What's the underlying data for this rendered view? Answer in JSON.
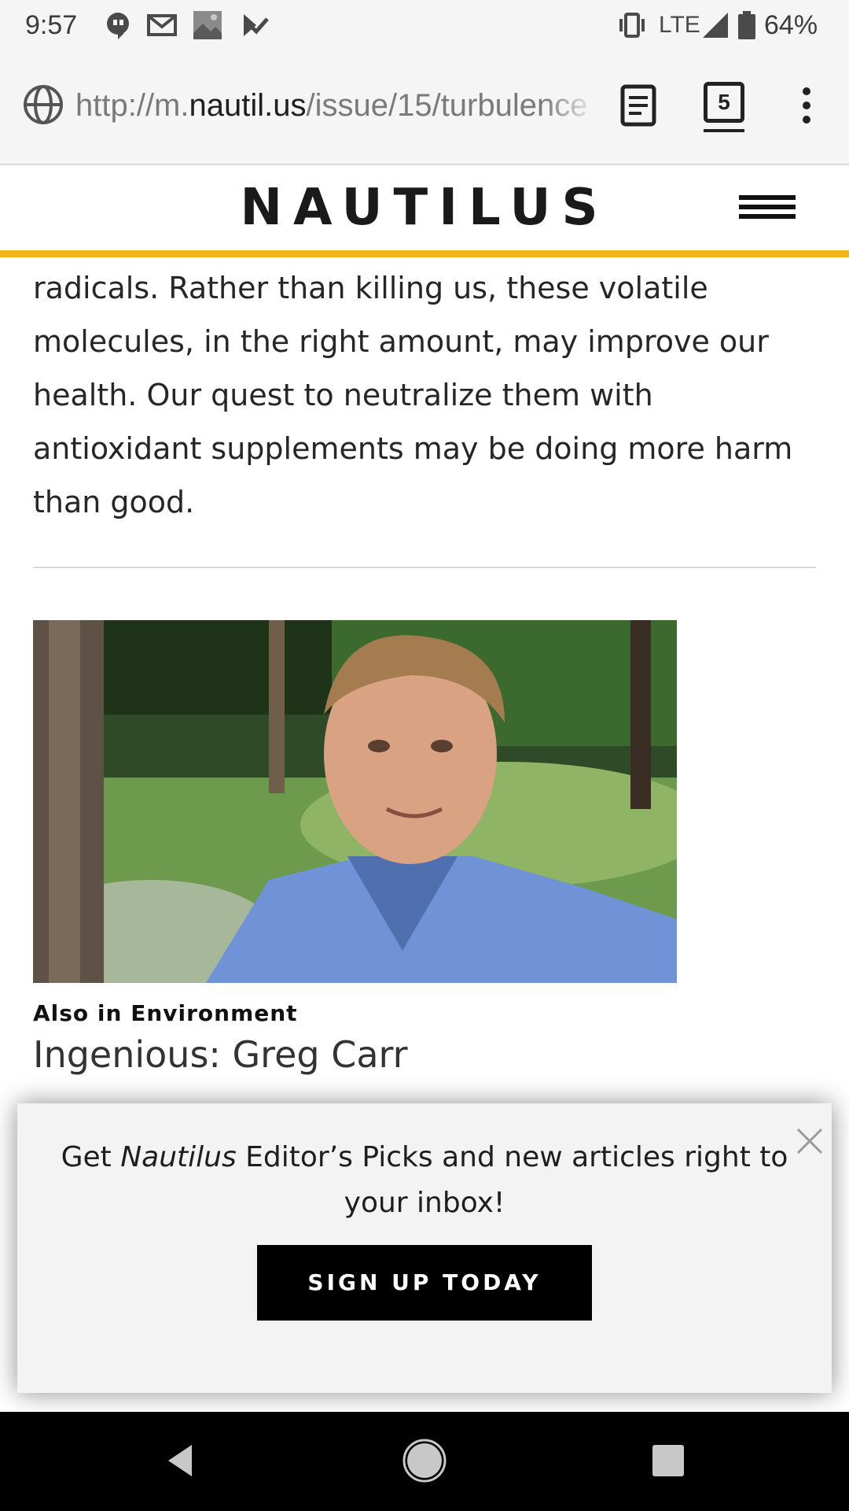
{
  "status_bar": {
    "time": "9:57",
    "network": "LTE",
    "battery": "64%",
    "icons": [
      "hangouts-icon",
      "gmail-icon",
      "photo-icon",
      "tasks-icon",
      "vibrate-icon",
      "signal-icon",
      "battery-icon"
    ]
  },
  "browser": {
    "url_prefix": "http://m.",
    "url_domain": "nautil.us",
    "url_path": "/issue/15/turbulence",
    "tab_count": "5",
    "icons": [
      "globe-icon",
      "reader-mode-icon",
      "tabs-icon",
      "more-vert-icon"
    ]
  },
  "site": {
    "logo": "NAUTILUS",
    "accent_color": "#f4b21b"
  },
  "article": {
    "paragraph": "radicals. Rather than killing us, these volatile molecules, in the right amount, may improve our health. Our quest to neutralize them with antioxidant supplements may be doing more harm than good."
  },
  "related": {
    "kicker": "Also in Environment",
    "title": "Ingenious: Greg Carr"
  },
  "popup": {
    "text_before": "Get ",
    "text_italic": "Nautilus",
    "text_after": " Editor’s Picks and new articles right to your inbox!",
    "button_label": "SIGN UP TODAY"
  },
  "nav": {
    "icons": [
      "back-icon",
      "home-icon",
      "recents-icon"
    ]
  }
}
